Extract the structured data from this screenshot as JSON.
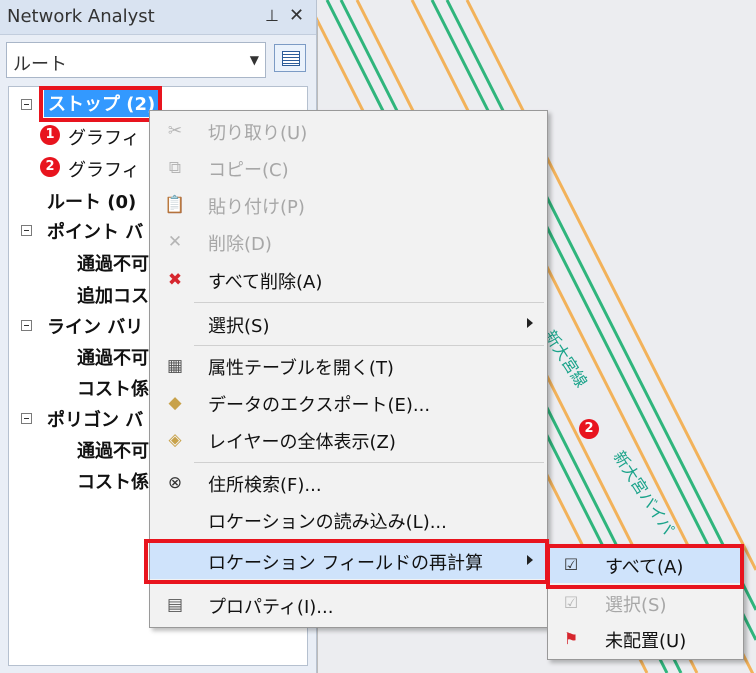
{
  "panel": {
    "title": "Network Analyst",
    "pin_icon": "pin-icon",
    "close_icon": "close-icon",
    "dropdown_value": "ルート",
    "properties_button_icon": "properties-icon"
  },
  "tree": {
    "stops": "ストップ (2)",
    "graphic1": "グラフィ",
    "graphic2": "グラフィ",
    "graphic1_badge": "1",
    "graphic2_badge": "2",
    "routes": "ルート (0)",
    "point_barriers": "ポイント バ",
    "point_child1": "通過不可",
    "point_child2": "追加コス",
    "line_barriers": "ライン バリ",
    "line_child1": "通過不可",
    "line_child2": "コスト係",
    "polygon_barriers": "ポリゴン バ",
    "polygon_child1": "通過不可",
    "polygon_child2": "コスト係"
  },
  "context_menu": {
    "cut": "切り取り(U)",
    "copy": "コピー(C)",
    "paste": "貼り付け(P)",
    "delete": "削除(D)",
    "delete_all": "すべて削除(A)",
    "select": "選択(S)",
    "open_attribute_table": "属性テーブルを開く(T)",
    "export_data": "データのエクスポート(E)...",
    "zoom_to_layer": "レイヤーの全体表示(Z)",
    "find_address": "住所検索(F)...",
    "load_locations": "ロケーションの読み込み(L)...",
    "recalc_location_fields": "ロケーション フィールドの再計算",
    "properties": "プロパティ(I)..."
  },
  "submenu": {
    "all": "すべて(A)",
    "selected": "選択(S)",
    "unlocated": "未配置(U)"
  },
  "map": {
    "label_a": "新大宮線",
    "label_b": "新大宮バイパ",
    "stop_badge": "2",
    "road_green": "#2fb57c",
    "road_orange": "#f2b25a"
  }
}
